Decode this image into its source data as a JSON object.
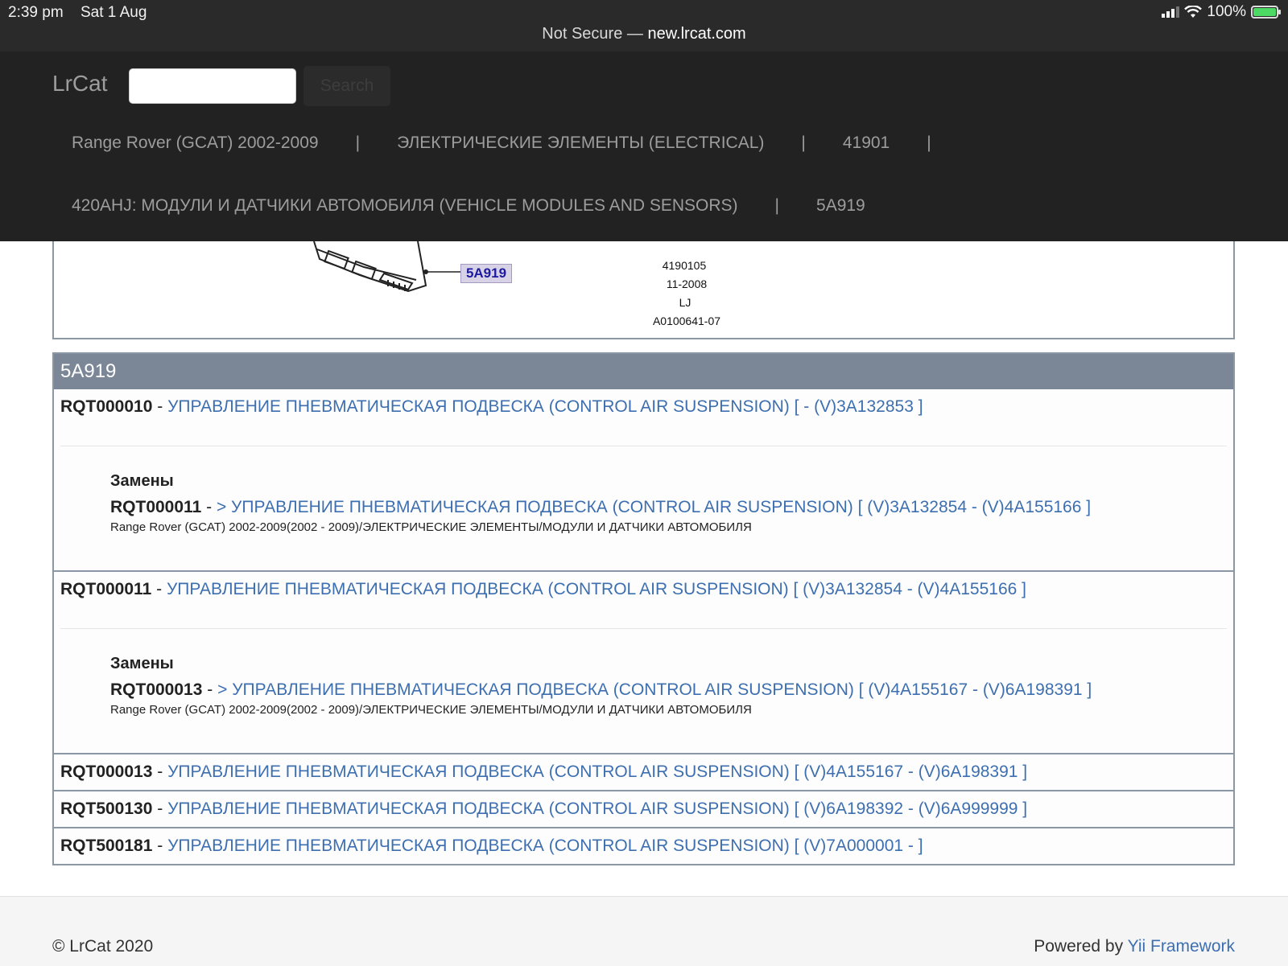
{
  "status_bar": {
    "time": "2:39 pm",
    "date": "Sat 1 Aug",
    "url_prefix": "Not Secure —",
    "url_host": "new.lrcat.com",
    "battery": "100%",
    "battery_level": 1.0
  },
  "navbar": {
    "brand": "LrCat",
    "search_placeholder": "",
    "search_label": "Search",
    "breadcrumbs": [
      "Range Rover (GCAT) 2002-2009",
      "ЭЛЕКТРИЧЕСКИЕ ЭЛЕМЕНТЫ (ELECTRICAL)",
      "41901",
      "420AHJ: МОДУЛИ И ДАТЧИКИ АВТОМОБИЛЯ (VEHICLE MODULES AND SENSORS)",
      "5A919"
    ],
    "separator": "|"
  },
  "diagram": {
    "callout": "5A919",
    "codes": [
      "4190105",
      "11-2008",
      "LJ",
      "A0100641-07"
    ]
  },
  "parts": {
    "heading": "5A919",
    "replacements_label": "Замены",
    "rows": [
      {
        "number": "RQT000010",
        "desc": "УПРАВЛЕНИЕ ПНЕВМАТИЧЕСКАЯ ПОДВЕСКА (CONTROL AIR SUSPENSION) [ - (V)3A132853 ]",
        "replacement": {
          "number": "RQT000011",
          "desc": "> УПРАВЛЕНИЕ ПНЕВМАТИЧЕСКАЯ ПОДВЕСКА (CONTROL AIR SUSPENSION) [ (V)3A132854 - (V)4A155166 ]",
          "path": "Range Rover (GCAT) 2002-2009(2002 - 2009)/ЭЛЕКТРИЧЕСКИЕ ЭЛЕМЕНТЫ/МОДУЛИ И ДАТЧИКИ АВТОМОБИЛЯ"
        }
      },
      {
        "number": "RQT000011",
        "desc": "УПРАВЛЕНИЕ ПНЕВМАТИЧЕСКАЯ ПОДВЕСКА (CONTROL AIR SUSPENSION) [ (V)3A132854 - (V)4A155166 ]",
        "replacement": {
          "number": "RQT000013",
          "desc": "> УПРАВЛЕНИЕ ПНЕВМАТИЧЕСКАЯ ПОДВЕСКА (CONTROL AIR SUSPENSION) [ (V)4A155167 - (V)6A198391 ]",
          "path": "Range Rover (GCAT) 2002-2009(2002 - 2009)/ЭЛЕКТРИЧЕСКИЕ ЭЛЕМЕНТЫ/МОДУЛИ И ДАТЧИКИ АВТОМОБИЛЯ"
        }
      },
      {
        "number": "RQT000013",
        "desc": "УПРАВЛЕНИЕ ПНЕВМАТИЧЕСКАЯ ПОДВЕСКА (CONTROL AIR SUSPENSION) [ (V)4A155167 - (V)6A198391 ]"
      },
      {
        "number": "RQT500130",
        "desc": "УПРАВЛЕНИЕ ПНЕВМАТИЧЕСКАЯ ПОДВЕСКА (CONTROL AIR SUSPENSION) [ (V)6A198392 - (V)6A999999 ]"
      },
      {
        "number": "RQT500181",
        "desc": "УПРАВЛЕНИЕ ПНЕВМАТИЧЕСКАЯ ПОДВЕСКА (CONTROL AIR SUSPENSION) [ (V)7A000001 - ]"
      }
    ],
    "dash": "-"
  },
  "footer": {
    "copyright": "© LrCat 2020",
    "powered_prefix": "Powered by",
    "powered_link": "Yii Framework"
  },
  "colors": {
    "navbar_bg": "#222222",
    "link": "#3d6fb0",
    "panel_heading": "#7b8797"
  }
}
